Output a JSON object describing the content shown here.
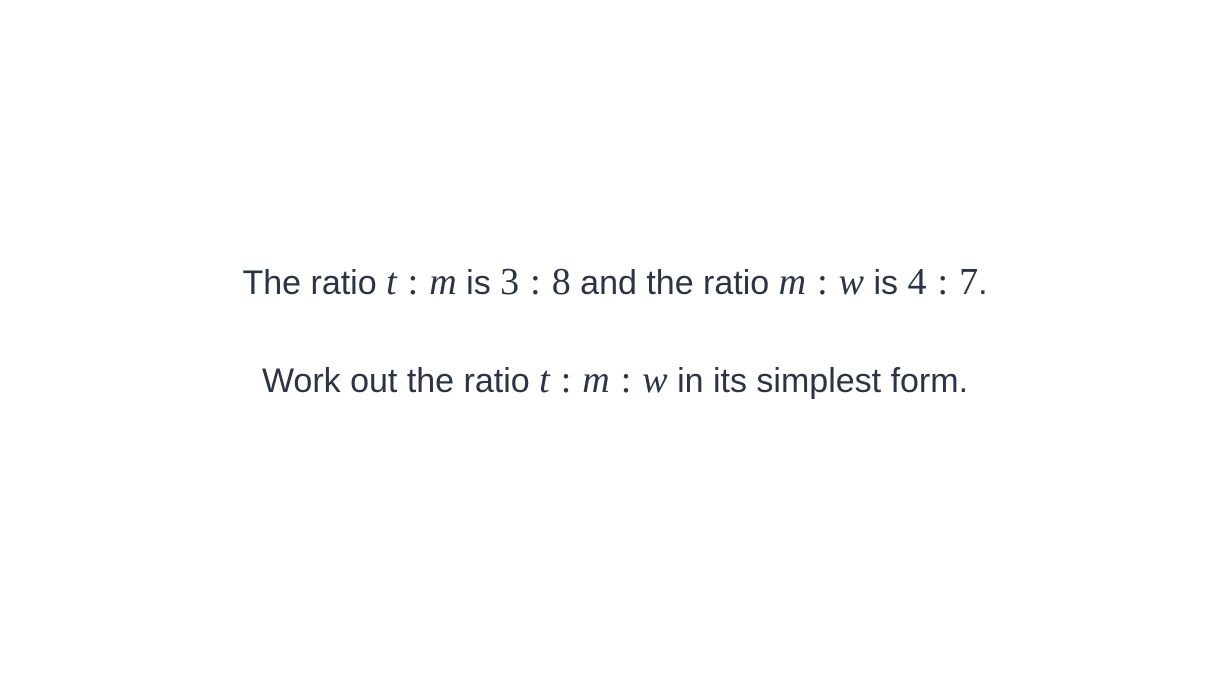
{
  "question": {
    "line1": {
      "text_1": "The ratio",
      "ratio_tm": {
        "first": "t",
        "second": "m"
      },
      "text_2": "is",
      "ratio_38": {
        "first": "3",
        "second": "8"
      },
      "text_3": "and the ratio",
      "ratio_mw": {
        "first": "m",
        "second": "w"
      },
      "text_4": "is",
      "ratio_47": {
        "first": "4",
        "second": "7"
      },
      "text_5": "."
    },
    "line2": {
      "text_1": "Work out the ratio",
      "ratio_tmw": {
        "first": "t",
        "second": "m",
        "third": "w"
      },
      "text_2": "in its simplest form."
    },
    "colon": ":"
  }
}
